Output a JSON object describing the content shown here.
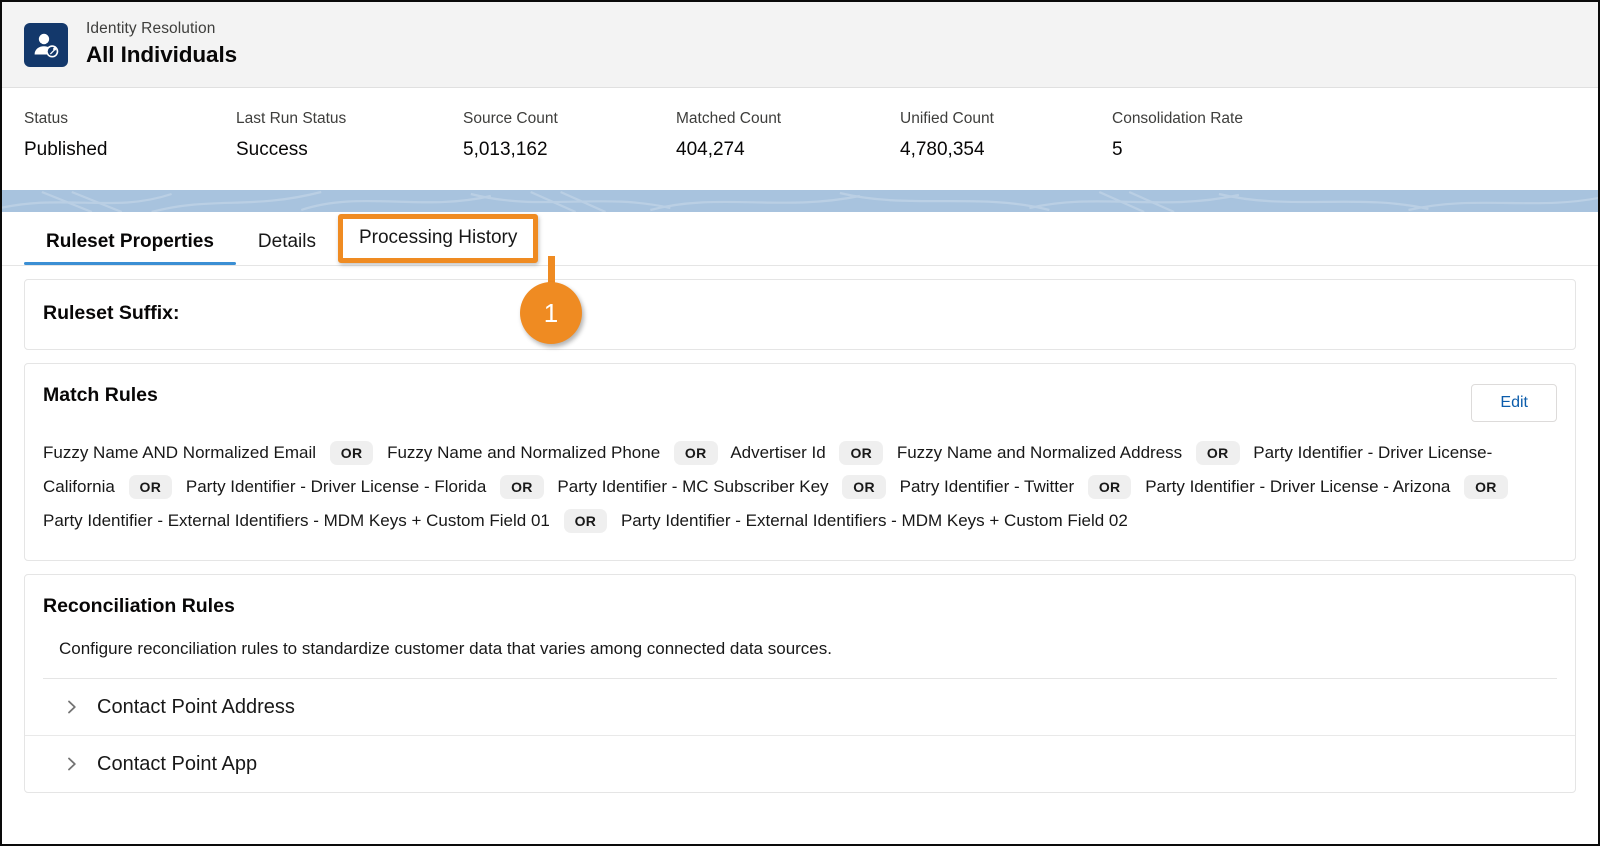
{
  "header": {
    "eyebrow": "Identity Resolution",
    "title": "All Individuals",
    "icon": "identity-person-badge-icon",
    "icon_bg": "#13386b"
  },
  "stats": [
    {
      "label": "Status",
      "value": "Published"
    },
    {
      "label": "Last Run Status",
      "value": "Success"
    },
    {
      "label": "Source Count",
      "value": "5,013,162"
    },
    {
      "label": "Matched Count",
      "value": "404,274"
    },
    {
      "label": "Unified Count",
      "value": "4,780,354"
    },
    {
      "label": "Consolidation Rate",
      "value": "5"
    }
  ],
  "banner": {
    "color": "#a8c3de"
  },
  "tabs": [
    {
      "label": "Ruleset Properties",
      "state": "active"
    },
    {
      "label": "Details",
      "state": "inactive"
    },
    {
      "label": "Processing History",
      "state": "highlighted"
    }
  ],
  "annotation": {
    "number": "1",
    "color": "#ef8b22",
    "target_tab": "Processing History"
  },
  "ruleset_suffix": {
    "title": "Ruleset Suffix:"
  },
  "match_rules": {
    "title": "Match Rules",
    "edit_label": "Edit",
    "separator": "OR",
    "rules": [
      "Fuzzy Name AND Normalized Email",
      "Fuzzy Name and Normalized Phone",
      "Advertiser Id",
      "Fuzzy Name and Normalized Address",
      "Party Identifier - Driver License- California",
      "Party Identifier - Driver License - Florida",
      "Party Identifier - MC Subscriber Key",
      "Patry Identifier - Twitter",
      "Party Identifier - Driver License - Arizona",
      "Party Identifier - External Identifiers - MDM Keys + Custom Field 01",
      "Party Identifier - External Identifiers - MDM Keys + Custom Field 02"
    ]
  },
  "reconciliation_rules": {
    "title": "Reconciliation Rules",
    "description": "Configure reconciliation rules to standardize customer data that varies among connected data sources.",
    "items": [
      {
        "label": "Contact Point Address",
        "expanded": false
      },
      {
        "label": "Contact Point App",
        "expanded": false
      }
    ]
  }
}
